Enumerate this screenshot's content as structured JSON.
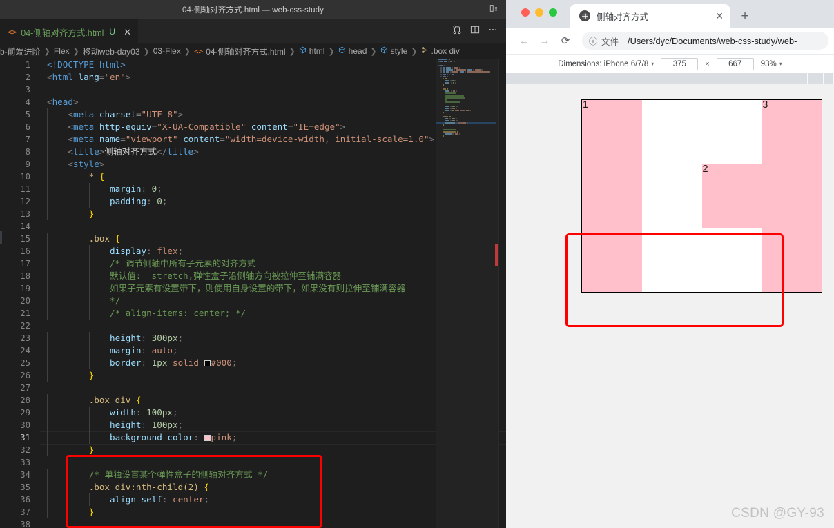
{
  "vscode": {
    "window_title": "04-侧轴对齐方式.html — web-css-study",
    "titlebar_icon": "layout-panel-icon",
    "tab": {
      "icon": "html-file-icon",
      "label": "04-侧轴对齐方式.html",
      "badge": "U",
      "close": "✕"
    },
    "tabbar_actions": [
      {
        "name": "split-source-control-icon",
        "glyph": "⑂"
      },
      {
        "name": "split-editor-icon",
        "glyph": "▣"
      },
      {
        "name": "more-actions-icon",
        "glyph": "⋯"
      }
    ],
    "breadcrumb": [
      {
        "icon": "",
        "text": "b-前端进阶"
      },
      {
        "icon": "",
        "text": "Flex"
      },
      {
        "icon": "",
        "text": "移动web-day03"
      },
      {
        "icon": "",
        "text": "03-Flex"
      },
      {
        "icon": "html-file-icon",
        "text": "04-侧轴对齐方式.html"
      },
      {
        "icon": "tag-icon",
        "text": "html"
      },
      {
        "icon": "tag-icon",
        "text": "head"
      },
      {
        "icon": "tag-icon",
        "text": "style"
      },
      {
        "icon": "css-rule-icon",
        "text": ".box div"
      }
    ],
    "active_line": 31,
    "code_lines": [
      {
        "n": 1,
        "tokens": [
          {
            "c": "t-doct",
            "t": "<!DOCTYPE "
          },
          {
            "c": "t-tag",
            "t": "html"
          },
          {
            "c": "t-doct",
            "t": ">"
          }
        ]
      },
      {
        "n": 2,
        "tokens": [
          {
            "c": "t-punct",
            "t": "<"
          },
          {
            "c": "t-tag",
            "t": "html"
          },
          {
            "c": "t-attr",
            "t": " lang"
          },
          {
            "c": "t-punct",
            "t": "="
          },
          {
            "c": "t-str",
            "t": "\"en\""
          },
          {
            "c": "t-punct",
            "t": ">"
          }
        ]
      },
      {
        "n": 3,
        "tokens": []
      },
      {
        "n": 4,
        "tokens": [
          {
            "c": "t-punct",
            "t": "<"
          },
          {
            "c": "t-tag",
            "t": "head"
          },
          {
            "c": "t-punct",
            "t": ">"
          }
        ]
      },
      {
        "n": 5,
        "tokens": [
          {
            "c": "t-text",
            "t": "    "
          },
          {
            "c": "t-punct",
            "t": "<"
          },
          {
            "c": "t-tag",
            "t": "meta"
          },
          {
            "c": "t-attr",
            "t": " charset"
          },
          {
            "c": "t-punct",
            "t": "="
          },
          {
            "c": "t-str",
            "t": "\"UTF-8\""
          },
          {
            "c": "t-punct",
            "t": ">"
          }
        ]
      },
      {
        "n": 6,
        "tokens": [
          {
            "c": "t-text",
            "t": "    "
          },
          {
            "c": "t-punct",
            "t": "<"
          },
          {
            "c": "t-tag",
            "t": "meta"
          },
          {
            "c": "t-attr",
            "t": " http-equiv"
          },
          {
            "c": "t-punct",
            "t": "="
          },
          {
            "c": "t-str",
            "t": "\"X-UA-Compatible\""
          },
          {
            "c": "t-attr",
            "t": " content"
          },
          {
            "c": "t-punct",
            "t": "="
          },
          {
            "c": "t-str",
            "t": "\"IE=edge\""
          },
          {
            "c": "t-punct",
            "t": ">"
          }
        ]
      },
      {
        "n": 7,
        "tokens": [
          {
            "c": "t-text",
            "t": "    "
          },
          {
            "c": "t-punct",
            "t": "<"
          },
          {
            "c": "t-tag",
            "t": "meta"
          },
          {
            "c": "t-attr",
            "t": " name"
          },
          {
            "c": "t-punct",
            "t": "="
          },
          {
            "c": "t-str",
            "t": "\"viewport\""
          },
          {
            "c": "t-attr",
            "t": " content"
          },
          {
            "c": "t-punct",
            "t": "="
          },
          {
            "c": "t-str",
            "t": "\"width=device-width, initial-scale=1.0\""
          },
          {
            "c": "t-punct",
            "t": ">"
          }
        ]
      },
      {
        "n": 8,
        "tokens": [
          {
            "c": "t-text",
            "t": "    "
          },
          {
            "c": "t-punct",
            "t": "<"
          },
          {
            "c": "t-tag",
            "t": "title"
          },
          {
            "c": "t-punct",
            "t": ">"
          },
          {
            "c": "t-text",
            "t": "侧轴对齐方式"
          },
          {
            "c": "t-punct",
            "t": "</"
          },
          {
            "c": "t-tag",
            "t": "title"
          },
          {
            "c": "t-punct",
            "t": ">"
          }
        ]
      },
      {
        "n": 9,
        "tokens": [
          {
            "c": "t-text",
            "t": "    "
          },
          {
            "c": "t-punct",
            "t": "<"
          },
          {
            "c": "t-tag",
            "t": "style"
          },
          {
            "c": "t-punct",
            "t": ">"
          }
        ]
      },
      {
        "n": 10,
        "tokens": [
          {
            "c": "t-text",
            "t": "        "
          },
          {
            "c": "t-sel",
            "t": "* "
          },
          {
            "c": "t-brace",
            "t": "{"
          }
        ]
      },
      {
        "n": 11,
        "tokens": [
          {
            "c": "t-text",
            "t": "            "
          },
          {
            "c": "t-prop",
            "t": "margin"
          },
          {
            "c": "t-punct",
            "t": ": "
          },
          {
            "c": "t-num",
            "t": "0"
          },
          {
            "c": "t-punct",
            "t": ";"
          }
        ]
      },
      {
        "n": 12,
        "tokens": [
          {
            "c": "t-text",
            "t": "            "
          },
          {
            "c": "t-prop",
            "t": "padding"
          },
          {
            "c": "t-punct",
            "t": ": "
          },
          {
            "c": "t-num",
            "t": "0"
          },
          {
            "c": "t-punct",
            "t": ";"
          }
        ]
      },
      {
        "n": 13,
        "tokens": [
          {
            "c": "t-text",
            "t": "        "
          },
          {
            "c": "t-brace",
            "t": "}"
          }
        ]
      },
      {
        "n": 14,
        "tokens": []
      },
      {
        "n": 15,
        "tokens": [
          {
            "c": "t-text",
            "t": "        "
          },
          {
            "c": "t-sel",
            "t": ".box "
          },
          {
            "c": "t-brace",
            "t": "{"
          }
        ]
      },
      {
        "n": 16,
        "tokens": [
          {
            "c": "t-text",
            "t": "            "
          },
          {
            "c": "t-prop",
            "t": "display"
          },
          {
            "c": "t-punct",
            "t": ": "
          },
          {
            "c": "t-val",
            "t": "flex"
          },
          {
            "c": "t-punct",
            "t": ";"
          }
        ]
      },
      {
        "n": 17,
        "tokens": [
          {
            "c": "t-text",
            "t": "            "
          },
          {
            "c": "t-cmt",
            "t": "/* 调节侧轴中所有子元素的对齐方式"
          }
        ]
      },
      {
        "n": 18,
        "tokens": [
          {
            "c": "t-text",
            "t": "            "
          },
          {
            "c": "t-cmt",
            "t": "默认值:  stretch,弹性盒子沿侧轴方向被拉伸至铺满容器"
          }
        ]
      },
      {
        "n": 19,
        "tokens": [
          {
            "c": "t-text",
            "t": "            "
          },
          {
            "c": "t-cmt",
            "t": "如果子元素有设置带下，则使用自身设置的带下，如果没有则拉伸至铺满容器"
          }
        ]
      },
      {
        "n": 20,
        "tokens": [
          {
            "c": "t-text",
            "t": "            "
          },
          {
            "c": "t-cmt",
            "t": "*/"
          }
        ]
      },
      {
        "n": 21,
        "tokens": [
          {
            "c": "t-text",
            "t": "            "
          },
          {
            "c": "t-cmt",
            "t": "/* align-items: center; */"
          }
        ]
      },
      {
        "n": 22,
        "tokens": []
      },
      {
        "n": 23,
        "tokens": [
          {
            "c": "t-text",
            "t": "            "
          },
          {
            "c": "t-prop",
            "t": "height"
          },
          {
            "c": "t-punct",
            "t": ": "
          },
          {
            "c": "t-num",
            "t": "300px"
          },
          {
            "c": "t-punct",
            "t": ";"
          }
        ]
      },
      {
        "n": 24,
        "tokens": [
          {
            "c": "t-text",
            "t": "            "
          },
          {
            "c": "t-prop",
            "t": "margin"
          },
          {
            "c": "t-punct",
            "t": ": "
          },
          {
            "c": "t-val",
            "t": "auto"
          },
          {
            "c": "t-punct",
            "t": ";"
          }
        ]
      },
      {
        "n": 25,
        "tokens": [
          {
            "c": "t-text",
            "t": "            "
          },
          {
            "c": "t-prop",
            "t": "border"
          },
          {
            "c": "t-punct",
            "t": ": "
          },
          {
            "c": "t-num",
            "t": "1px"
          },
          {
            "c": "t-val",
            "t": " solid "
          },
          {
            "c": "sw",
            "t": "sw-black"
          },
          {
            "c": "t-val",
            "t": "#000"
          },
          {
            "c": "t-punct",
            "t": ";"
          }
        ]
      },
      {
        "n": 26,
        "tokens": [
          {
            "c": "t-text",
            "t": "        "
          },
          {
            "c": "t-brace",
            "t": "}"
          }
        ]
      },
      {
        "n": 27,
        "tokens": []
      },
      {
        "n": 28,
        "tokens": [
          {
            "c": "t-text",
            "t": "        "
          },
          {
            "c": "t-sel",
            "t": ".box div "
          },
          {
            "c": "t-brace",
            "t": "{"
          }
        ]
      },
      {
        "n": 29,
        "tokens": [
          {
            "c": "t-text",
            "t": "            "
          },
          {
            "c": "t-prop",
            "t": "width"
          },
          {
            "c": "t-punct",
            "t": ": "
          },
          {
            "c": "t-num",
            "t": "100px"
          },
          {
            "c": "t-punct",
            "t": ";"
          }
        ]
      },
      {
        "n": 30,
        "tokens": [
          {
            "c": "t-text",
            "t": "            "
          },
          {
            "c": "t-prop",
            "t": "height"
          },
          {
            "c": "t-punct",
            "t": ": "
          },
          {
            "c": "t-num",
            "t": "100px"
          },
          {
            "c": "t-punct",
            "t": ";"
          }
        ]
      },
      {
        "n": 31,
        "tokens": [
          {
            "c": "t-text",
            "t": "            "
          },
          {
            "c": "t-prop",
            "t": "background-color"
          },
          {
            "c": "t-punct",
            "t": ": "
          },
          {
            "c": "sw",
            "t": "sw-pink"
          },
          {
            "c": "t-val",
            "t": "pink"
          },
          {
            "c": "t-punct",
            "t": ";"
          }
        ]
      },
      {
        "n": 32,
        "tokens": [
          {
            "c": "t-text",
            "t": "        "
          },
          {
            "c": "t-brace",
            "t": "}"
          }
        ]
      },
      {
        "n": 33,
        "tokens": []
      },
      {
        "n": 34,
        "tokens": [
          {
            "c": "t-text",
            "t": "        "
          },
          {
            "c": "t-cmt",
            "t": "/* 单独设置某个弹性盒子的侧轴对齐方式 */"
          }
        ]
      },
      {
        "n": 35,
        "tokens": [
          {
            "c": "t-text",
            "t": "        "
          },
          {
            "c": "t-sel",
            "t": ".box div:nth-child(2) "
          },
          {
            "c": "t-brace",
            "t": "{"
          }
        ]
      },
      {
        "n": 36,
        "tokens": [
          {
            "c": "t-text",
            "t": "            "
          },
          {
            "c": "t-prop",
            "t": "align-self"
          },
          {
            "c": "t-punct",
            "t": ": "
          },
          {
            "c": "t-val",
            "t": "center"
          },
          {
            "c": "t-punct",
            "t": ";"
          }
        ]
      },
      {
        "n": 37,
        "tokens": [
          {
            "c": "t-text",
            "t": "        "
          },
          {
            "c": "t-brace",
            "t": "}"
          }
        ]
      },
      {
        "n": 38,
        "tokens": []
      }
    ],
    "code_annotation": {
      "label": "align-self-rule-highlight",
      "color": "#ff0000"
    }
  },
  "chrome": {
    "traffic_lights": [
      "close",
      "minimize",
      "zoom"
    ],
    "tab": {
      "title": "侧轴对齐方式",
      "favicon": "globe-icon",
      "close": "✕"
    },
    "new_tab": "+",
    "nav": {
      "back": "←",
      "forward": "→",
      "reload": "⟳"
    },
    "omnibox": {
      "info_icon": "ⓘ",
      "scheme_label": "文件",
      "url": "/Users/dyc/Documents/web-css-study/web-"
    },
    "device_toolbar": {
      "dimensions_label": "Dimensions: iPhone 6/7/8",
      "width": "375",
      "separator": "×",
      "height": "667",
      "zoom": "93%",
      "caret": "▾"
    },
    "preview": {
      "items": [
        {
          "label": "1",
          "mode": "stretch"
        },
        {
          "label": "",
          "mode": "spacer"
        },
        {
          "label": "2",
          "mode": "fixed"
        },
        {
          "label": "3",
          "mode": "stretch"
        }
      ],
      "box_border_color": "#000000",
      "item_background": "#ffc0cb",
      "annotation_color": "#ff0000"
    },
    "watermark": "CSDN @GY-93"
  }
}
